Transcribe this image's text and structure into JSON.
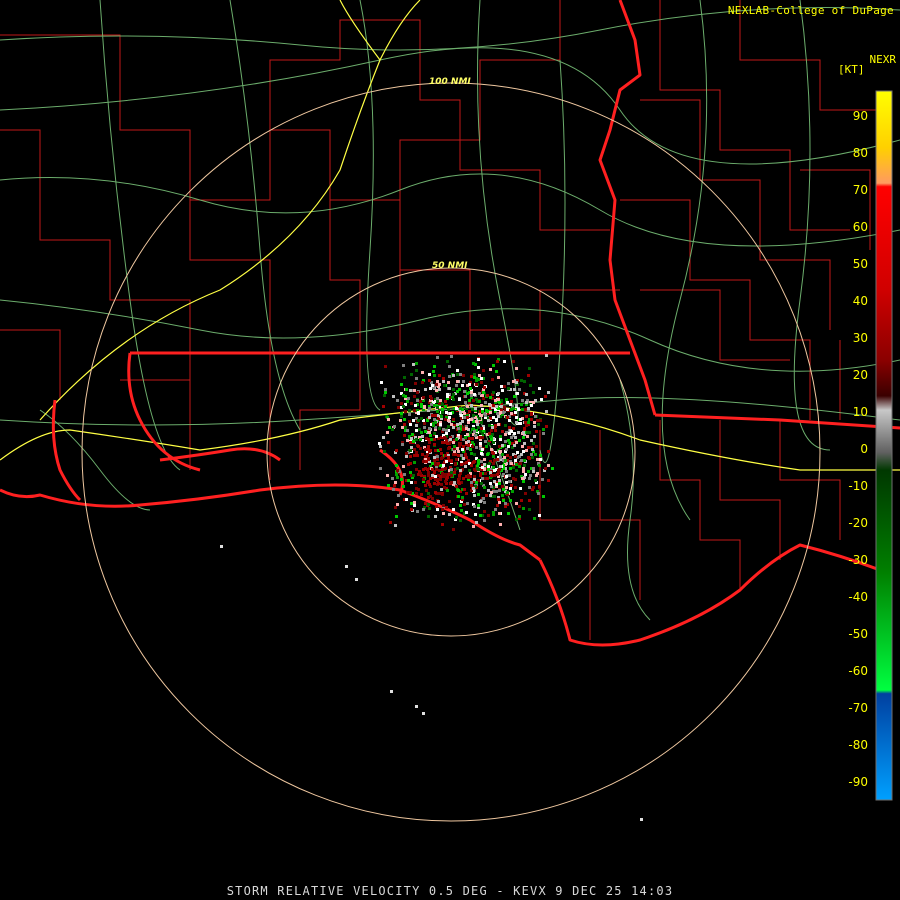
{
  "credit": "NEXLAB-College of DuPage",
  "product_id": "NEXR",
  "units": "[KT]",
  "footer": "STORM RELATIVE VELOCITY 0.5 DEG - KEVX 9 DEC 25 14:03",
  "range_rings": [
    {
      "label": "100 NMI"
    },
    {
      "label": "50 NMI"
    }
  ],
  "legend": {
    "ticks": [
      "90",
      "80",
      "70",
      "60",
      "50",
      "40",
      "30",
      "20",
      "10",
      "0",
      "-10",
      "-20",
      "-30",
      "-40",
      "-50",
      "-60",
      "-70",
      "-80",
      "-90"
    ]
  },
  "colors": {
    "state_border": "#ff2020",
    "county_border": "#c81e1e",
    "highway": "#ffff44",
    "road": "#80c880",
    "range_ring": "#f0c8a0",
    "text": "#ffff00"
  }
}
